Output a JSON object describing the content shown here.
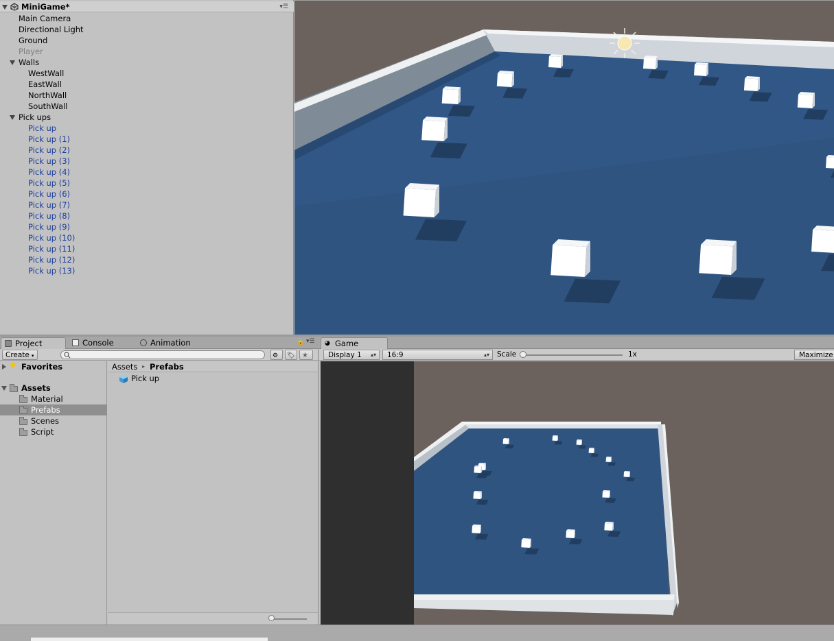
{
  "hierarchy": {
    "scene_name": "MiniGame*",
    "items": [
      {
        "label": "Main Camera",
        "indent": 0,
        "style": "normal"
      },
      {
        "label": "Directional Light",
        "indent": 0,
        "style": "normal"
      },
      {
        "label": "Ground",
        "indent": 0,
        "style": "normal"
      },
      {
        "label": "Player",
        "indent": 0,
        "style": "dim"
      },
      {
        "label": "Walls",
        "indent": 0,
        "style": "normal",
        "expanded": true
      },
      {
        "label": "WestWall",
        "indent": 1,
        "style": "normal"
      },
      {
        "label": "EastWall",
        "indent": 1,
        "style": "normal"
      },
      {
        "label": "NorthWall",
        "indent": 1,
        "style": "normal"
      },
      {
        "label": "SouthWall",
        "indent": 1,
        "style": "normal"
      },
      {
        "label": "Pick ups",
        "indent": 0,
        "style": "normal",
        "expanded": true
      },
      {
        "label": "Pick up",
        "indent": 1,
        "style": "blue"
      },
      {
        "label": "Pick up (1)",
        "indent": 1,
        "style": "blue"
      },
      {
        "label": "Pick up (2)",
        "indent": 1,
        "style": "blue"
      },
      {
        "label": "Pick up (3)",
        "indent": 1,
        "style": "blue"
      },
      {
        "label": "Pick up (4)",
        "indent": 1,
        "style": "blue"
      },
      {
        "label": "Pick up (5)",
        "indent": 1,
        "style": "blue"
      },
      {
        "label": "Pick up (6)",
        "indent": 1,
        "style": "blue"
      },
      {
        "label": "Pick up (7)",
        "indent": 1,
        "style": "blue"
      },
      {
        "label": "Pick up (8)",
        "indent": 1,
        "style": "blue"
      },
      {
        "label": "Pick up (9)",
        "indent": 1,
        "style": "blue"
      },
      {
        "label": "Pick up (10)",
        "indent": 1,
        "style": "blue"
      },
      {
        "label": "Pick up (11)",
        "indent": 1,
        "style": "blue"
      },
      {
        "label": "Pick up (12)",
        "indent": 1,
        "style": "blue"
      },
      {
        "label": "Pick up (13)",
        "indent": 1,
        "style": "blue"
      }
    ]
  },
  "project_panel": {
    "tabs": [
      {
        "label": "Project",
        "active": true,
        "icon": "folder-icon"
      },
      {
        "label": "Console",
        "active": false,
        "icon": "console-icon"
      },
      {
        "label": "Animation",
        "active": false,
        "icon": "clock-icon"
      }
    ],
    "create_label": "Create",
    "search_placeholder": "",
    "favorites_label": "Favorites",
    "assets_label": "Assets",
    "folders": [
      "Material",
      "Prefabs",
      "Scenes",
      "Script"
    ],
    "selected_folder": "Prefabs",
    "breadcrumb": [
      "Assets",
      "Prefabs"
    ],
    "files": [
      {
        "label": "Pick up",
        "icon": "prefab-cube-icon"
      }
    ]
  },
  "game_panel": {
    "tab_label": "Game",
    "display_label": "Display 1",
    "aspect_label": "16:9",
    "scale_label": "Scale",
    "scale_value": "1x",
    "scale_fraction": 0.0,
    "maximize_label": "Maximize On Play"
  },
  "colors": {
    "panel_bg": "#c2c2c2",
    "selection": "#8f8f8f",
    "sky": "#6b625d",
    "floor": "#2f5480",
    "wall": "#dfe3e6",
    "blue_prefab_text": "#1a3e9c"
  }
}
